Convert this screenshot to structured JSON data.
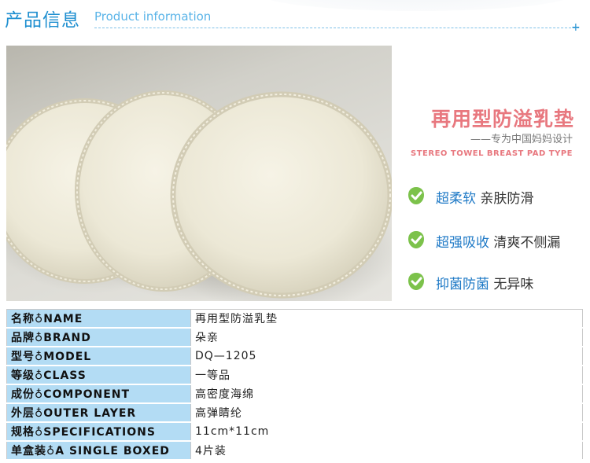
{
  "header": {
    "title_cn": "产品信息",
    "title_en": "Product information",
    "plus": "+"
  },
  "promo": {
    "heading": "再用型防溢乳垫",
    "subtitle": "——专为中国妈妈设计",
    "subtitle_en": "STEREO TOWEL BREAST PAD TYPE",
    "features": [
      {
        "icon": "check-shield-icon",
        "part1": "超柔软",
        "part2": "亲肤防滑"
      },
      {
        "icon": "check-shield-icon",
        "part1": "超强吸收",
        "part2": "清爽不侧漏"
      },
      {
        "icon": "check-shield-icon",
        "part1": "抑菌防菌",
        "part2": "无异味"
      }
    ]
  },
  "specs": [
    {
      "key": "名称♁NAME",
      "value": "再用型防溢乳垫"
    },
    {
      "key": "品牌♁BRAND",
      "value": "朵亲"
    },
    {
      "key": "型号♁MODEL",
      "value": "DQ—1205"
    },
    {
      "key": "等级♁CLASS",
      "value": "一等品"
    },
    {
      "key": "成份♁COMPONENT",
      "value": "高密度海绵"
    },
    {
      "key": "外层♁OUTER LAYER",
      "value": "高弹睛纶"
    },
    {
      "key": "规格♁SPECIFICATIONS",
      "value": "11cm*11cm"
    },
    {
      "key": "单盒装♁A SINGLE BOXED",
      "value": "4片装"
    }
  ],
  "colors": {
    "accent_blue": "#1f8fd0",
    "heading_pink": "#e8787f",
    "icon_green": "#7cc24b",
    "table_key_bg": "#b3dcf4"
  }
}
